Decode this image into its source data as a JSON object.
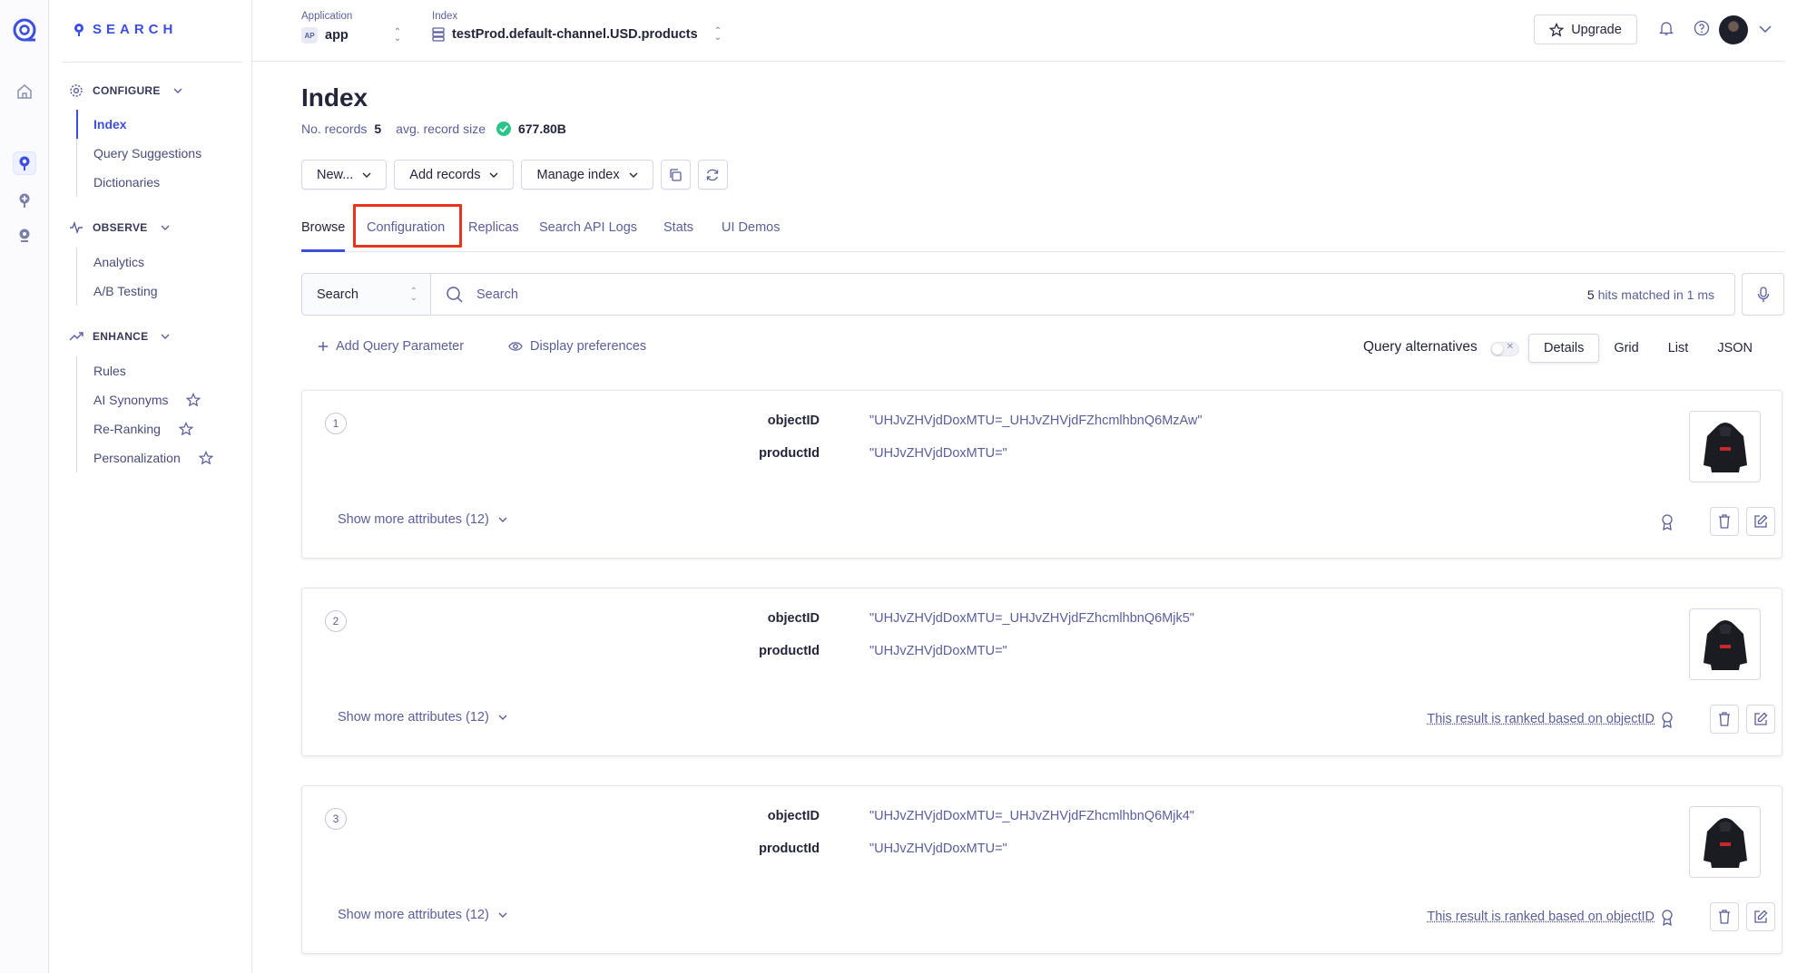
{
  "brand": {
    "name": "SEARCH"
  },
  "sidebar": {
    "sections": [
      {
        "label": "CONFIGURE",
        "icon": "gear-icon",
        "items": [
          {
            "label": "Index",
            "active": true
          },
          {
            "label": "Query Suggestions"
          },
          {
            "label": "Dictionaries"
          }
        ]
      },
      {
        "label": "OBSERVE",
        "icon": "pulse-icon",
        "items": [
          {
            "label": "Analytics"
          },
          {
            "label": "A/B Testing"
          }
        ]
      },
      {
        "label": "ENHANCE",
        "icon": "trend-up-icon",
        "items": [
          {
            "label": "Rules"
          },
          {
            "label": "AI Synonyms",
            "star": true
          },
          {
            "label": "Re-Ranking",
            "star": true
          },
          {
            "label": "Personalization",
            "star": true
          }
        ]
      }
    ]
  },
  "topbar": {
    "application_label": "Application",
    "application_badge": "AP",
    "application_value": "app",
    "index_label": "Index",
    "index_value": "testProd.default-channel.USD.products",
    "upgrade_label": "Upgrade"
  },
  "page": {
    "title": "Index",
    "records_label": "No. records",
    "records_value": "5",
    "size_label": "avg. record size",
    "size_value": "677.80B"
  },
  "buttons": {
    "new": "New...",
    "add_records": "Add records",
    "manage_index": "Manage index"
  },
  "tabs": [
    "Browse",
    "Configuration",
    "Replicas",
    "Search API Logs",
    "Stats",
    "UI Demos"
  ],
  "active_tab": "Browse",
  "highlighted_tab": "Configuration",
  "search": {
    "mode": "Search",
    "placeholder": "Search",
    "hits_count": "5",
    "hits_text": "hits matched in 1 ms"
  },
  "options": {
    "add_query_param": "Add Query Parameter",
    "display_prefs": "Display preferences",
    "query_alternatives": "Query alternatives",
    "views": [
      "Details",
      "Grid",
      "List",
      "JSON"
    ],
    "active_view": "Details"
  },
  "records": [
    {
      "rank": "1",
      "objectID_key": "objectID",
      "objectID": "\"UHJvZHVjdDoxMTU=_UHJvZHVjdFZhcmlhbnQ6MzAw\"",
      "productId_key": "productId",
      "productId": "\"UHJvZHVjdDoxMTU=\"",
      "more": "Show more attributes (12)",
      "ranked_note": ""
    },
    {
      "rank": "2",
      "objectID_key": "objectID",
      "objectID": "\"UHJvZHVjdDoxMTU=_UHJvZHVjdFZhcmlhbnQ6Mjk5\"",
      "productId_key": "productId",
      "productId": "\"UHJvZHVjdDoxMTU=\"",
      "more": "Show more attributes (12)",
      "ranked_note": "This result is ranked based on objectID"
    },
    {
      "rank": "3",
      "objectID_key": "objectID",
      "objectID": "\"UHJvZHVjdDoxMTU=_UHJvZHVjdFZhcmlhbnQ6Mjk4\"",
      "productId_key": "productId",
      "productId": "\"UHJvZHVjdDoxMTU=\"",
      "more": "Show more attributes (12)",
      "ranked_note": "This result is ranked based on objectID"
    }
  ],
  "colors": {
    "accent": "#3c4fe0",
    "highlight": "#e8341c",
    "ok": "#2bc48a"
  }
}
